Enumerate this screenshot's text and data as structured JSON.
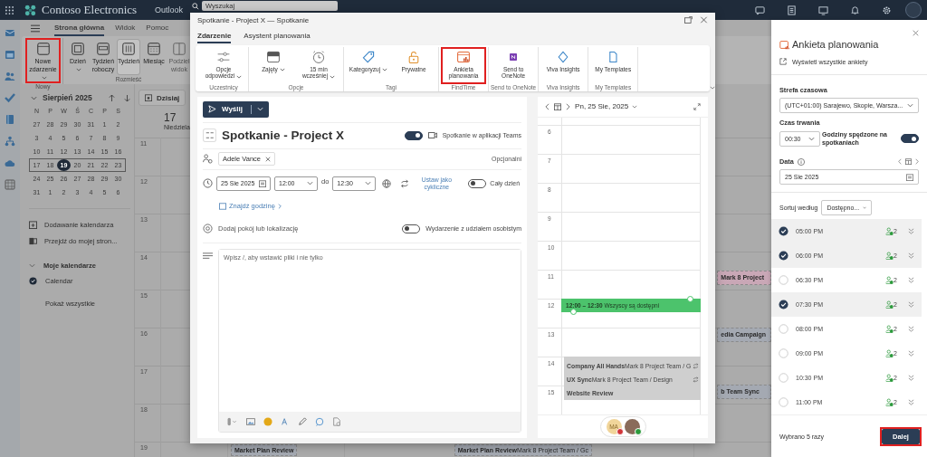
{
  "top_bar": {
    "app_name": "Contoso Electronics",
    "module": "Outlook",
    "search": {
      "placeholder": "Wyszukaj"
    }
  },
  "ribbon_tabs": [
    {
      "label": "Strona główna",
      "selected": true
    },
    {
      "label": "Widok",
      "selected": false
    },
    {
      "label": "Pomoc",
      "selected": false
    }
  ],
  "ribbon": {
    "groups": [
      {
        "label": "Nowy",
        "buttons": [
          {
            "label": "Nowe zdarzenie",
            "kind": "new",
            "dropdown": true,
            "selected": false,
            "disabled": false,
            "highlighted": true
          }
        ]
      },
      {
        "label": "Rozmieść",
        "buttons": [
          {
            "label": "Dzień",
            "kind": "day",
            "dropdown": true,
            "selected": false,
            "disabled": false,
            "highlighted": false
          },
          {
            "label": "Tydzień roboczy",
            "kind": "workweek",
            "dropdown": false,
            "selected": false,
            "disabled": false,
            "highlighted": false
          },
          {
            "label": "Tydzień",
            "kind": "week",
            "dropdown": false,
            "selected": true,
            "disabled": false,
            "highlighted": false
          },
          {
            "label": "Miesiąc",
            "kind": "month",
            "dropdown": false,
            "selected": false,
            "disabled": false,
            "highlighted": false
          },
          {
            "label": "Podziel widok",
            "kind": "split",
            "dropdown": false,
            "selected": false,
            "disabled": true,
            "highlighted": false
          }
        ]
      }
    ]
  },
  "mini_calendar": {
    "title": "Sierpień 2025",
    "weekdays": [
      "N",
      "P",
      "W",
      "Ś",
      "C",
      "P",
      "S"
    ],
    "weeks": [
      {
        "current": false,
        "days": [
          {
            "d": "27",
            "selected": false
          },
          {
            "d": "28",
            "selected": false
          },
          {
            "d": "29",
            "selected": false
          },
          {
            "d": "30",
            "selected": false
          },
          {
            "d": "31",
            "selected": false
          },
          {
            "d": "1",
            "selected": false
          },
          {
            "d": "2",
            "selected": false
          }
        ]
      },
      {
        "current": false,
        "days": [
          {
            "d": "3",
            "selected": false
          },
          {
            "d": "4",
            "selected": false
          },
          {
            "d": "5",
            "selected": false
          },
          {
            "d": "6",
            "selected": false
          },
          {
            "d": "7",
            "selected": false
          },
          {
            "d": "8",
            "selected": false
          },
          {
            "d": "9",
            "selected": false
          }
        ]
      },
      {
        "current": false,
        "days": [
          {
            "d": "10",
            "selected": false
          },
          {
            "d": "11",
            "selected": false
          },
          {
            "d": "12",
            "selected": false
          },
          {
            "d": "13",
            "selected": false
          },
          {
            "d": "14",
            "selected": false
          },
          {
            "d": "15",
            "selected": false
          },
          {
            "d": "16",
            "selected": false
          }
        ]
      },
      {
        "current": true,
        "days": [
          {
            "d": "17",
            "selected": false
          },
          {
            "d": "18",
            "selected": false
          },
          {
            "d": "19",
            "selected": true
          },
          {
            "d": "20",
            "selected": false
          },
          {
            "d": "21",
            "selected": false
          },
          {
            "d": "22",
            "selected": false
          },
          {
            "d": "23",
            "selected": false
          }
        ]
      },
      {
        "current": false,
        "days": [
          {
            "d": "24",
            "selected": false
          },
          {
            "d": "25",
            "selected": false
          },
          {
            "d": "26",
            "selected": false
          },
          {
            "d": "27",
            "selected": false
          },
          {
            "d": "28",
            "selected": false
          },
          {
            "d": "29",
            "selected": false
          },
          {
            "d": "30",
            "selected": false
          }
        ]
      },
      {
        "current": false,
        "days": [
          {
            "d": "31",
            "selected": false
          },
          {
            "d": "1",
            "selected": false
          },
          {
            "d": "2",
            "selected": false
          },
          {
            "d": "3",
            "selected": false
          },
          {
            "d": "4",
            "selected": false
          },
          {
            "d": "5",
            "selected": false
          },
          {
            "d": "6",
            "selected": false
          }
        ]
      }
    ]
  },
  "left_links": [
    {
      "label": "Dodawanie kalendarza",
      "kind": "add"
    },
    {
      "label": "Przejdź do mojej stron...",
      "kind": "page"
    }
  ],
  "my_calendars": {
    "label": "Moje kalendarze",
    "expanded": true,
    "items": [
      {
        "label": "Calendar",
        "checked": true
      }
    ],
    "show_all": "Pokaż wszystkie"
  },
  "calendar": {
    "today_button": "Dzisiaj",
    "day_header": {
      "number": "17",
      "name": "Niedziela"
    },
    "hours": [
      "11",
      "12",
      "13",
      "14",
      "15",
      "16",
      "17",
      "18",
      "19"
    ],
    "side_events": [
      {
        "title": "Mark 8 Project",
        "color": "#c9a7b6"
      },
      {
        "title": "edia Campaign",
        "color": "#a4a9b2"
      },
      {
        "title": "b Team Sync",
        "color": "#a4a9b2"
      }
    ],
    "bottom_events": [
      {
        "title": "Market Plan Review",
        "color": "#a4a9b2"
      },
      {
        "title": "Market Plan Review",
        "detail": "Mark 8 Project Team / Gc",
        "color": "#a4a9b2"
      }
    ]
  },
  "dialog": {
    "title": "Spotkanie - Project X — Spotkanie",
    "tabs": [
      {
        "label": "Zdarzenie",
        "selected": true
      },
      {
        "label": "Asystent planowania",
        "selected": false
      }
    ],
    "ribbon_groups": [
      {
        "label": "Uczestnicy",
        "buttons": [
          {
            "label": "Opcje odpowiedzi",
            "kind": "sliders",
            "dropdown": true,
            "highlighted": false
          }
        ]
      },
      {
        "label": "Opcje",
        "buttons": [
          {
            "label": "Zajęty",
            "kind": "busy",
            "dropdown": true,
            "highlighted": false
          },
          {
            "label": "15 min wcześniej",
            "kind": "alarm",
            "dropdown": true,
            "highlighted": false
          }
        ]
      },
      {
        "label": "Tagi",
        "buttons": [
          {
            "label": "Kategoryzuj",
            "kind": "tag",
            "dropdown": true,
            "highlighted": false
          },
          {
            "label": "Prywatne",
            "kind": "lock",
            "dropdown": false,
            "highlighted": false
          }
        ]
      },
      {
        "label": "FindTime",
        "buttons": [
          {
            "label": "Ankieta planowania",
            "kind": "poll",
            "dropdown": false,
            "highlighted": true
          }
        ]
      },
      {
        "label": "Send to OneNote",
        "buttons": [
          {
            "label": "Send to OneNote",
            "kind": "onenote",
            "dropdown": false,
            "highlighted": false
          }
        ]
      },
      {
        "label": "Viva Insights",
        "buttons": [
          {
            "label": "Viva Insights",
            "kind": "viva",
            "dropdown": false,
            "highlighted": false
          }
        ]
      },
      {
        "label": "My Templates",
        "buttons": [
          {
            "label": "My Templates",
            "kind": "templates",
            "dropdown": false,
            "highlighted": false
          }
        ]
      }
    ],
    "send_button": "Wyślij",
    "subject": "Spotkanie - Project X",
    "teams": {
      "label": "Spotkanie w aplikacji Teams",
      "on": true
    },
    "attendees": [
      {
        "name": "Adele Vance"
      }
    ],
    "optional_label": "Opcjonalni",
    "start_date": "25 Sie 2025",
    "start_time": "12:00",
    "to_label": "do",
    "end_time": "12:30",
    "recurring_label": "Ustaw jako cykliczne",
    "all_day": {
      "label": "Cały dzień",
      "on": false
    },
    "find_time": "Znajdź godzinę",
    "location": {
      "placeholder": "Dodaj pokój lub lokalizację"
    },
    "in_person": {
      "label": "Wydarzenie z udziałem osobistym",
      "on": false
    },
    "body": {
      "placeholder": "Wpisz /, aby wstawić pliki i nie tylko"
    },
    "day_view": {
      "date": "Pn, 25 Sie, 2025",
      "hours": [
        "6",
        "7",
        "8",
        "9",
        "10",
        "11",
        "12",
        "13",
        "14",
        "15"
      ],
      "proposed": {
        "time": "12:00 – 12:30",
        "label": "Wszyscy są dostępni"
      },
      "events": [
        {
          "title": "Company All Hands",
          "detail": "Mark 8 Project Team / G",
          "recurring": true
        },
        {
          "title": "UX Sync",
          "detail": "Mark 8 Project Team / Design",
          "recurring": true
        },
        {
          "title": "Website Review",
          "recurring": false
        }
      ]
    },
    "participants": [
      {
        "kind": "initials",
        "initials": "MA",
        "color": "#d13438"
      },
      {
        "kind": "photo",
        "color": "#2c9a3c"
      }
    ]
  },
  "poll_panel": {
    "title": "Ankieta planowania",
    "view_all": "Wyświetl wszystkie ankiety",
    "timezone_label": "Strefa czasowa",
    "timezone": "(UTC+01:00) Sarajewo, Skopie, Warsza...",
    "duration_label": "Czas trwania",
    "duration": "00:30",
    "working_hours": {
      "label": "Godziny spędzone na spotkaniach",
      "on": true
    },
    "date_label": "Data",
    "date": "25 Sie 2025",
    "sort_label": "Sortuj według",
    "sort_value": "Dostępno...",
    "slots": [
      {
        "time": "05:00 PM",
        "checked": true,
        "attendees": "2"
      },
      {
        "time": "06:00 PM",
        "checked": true,
        "attendees": "2"
      },
      {
        "time": "06:30 PM",
        "checked": false,
        "attendees": "2"
      },
      {
        "time": "07:30 PM",
        "checked": true,
        "attendees": "2"
      },
      {
        "time": "08:00 PM",
        "checked": false,
        "attendees": "2"
      },
      {
        "time": "09:00 PM",
        "checked": false,
        "attendees": "2"
      },
      {
        "time": "10:30 PM",
        "checked": false,
        "attendees": "2"
      },
      {
        "time": "11:00 PM",
        "checked": false,
        "attendees": "2"
      }
    ],
    "summary": "Wybrano 5 razy",
    "next_button": {
      "label": "Dalej",
      "highlighted": true
    }
  }
}
